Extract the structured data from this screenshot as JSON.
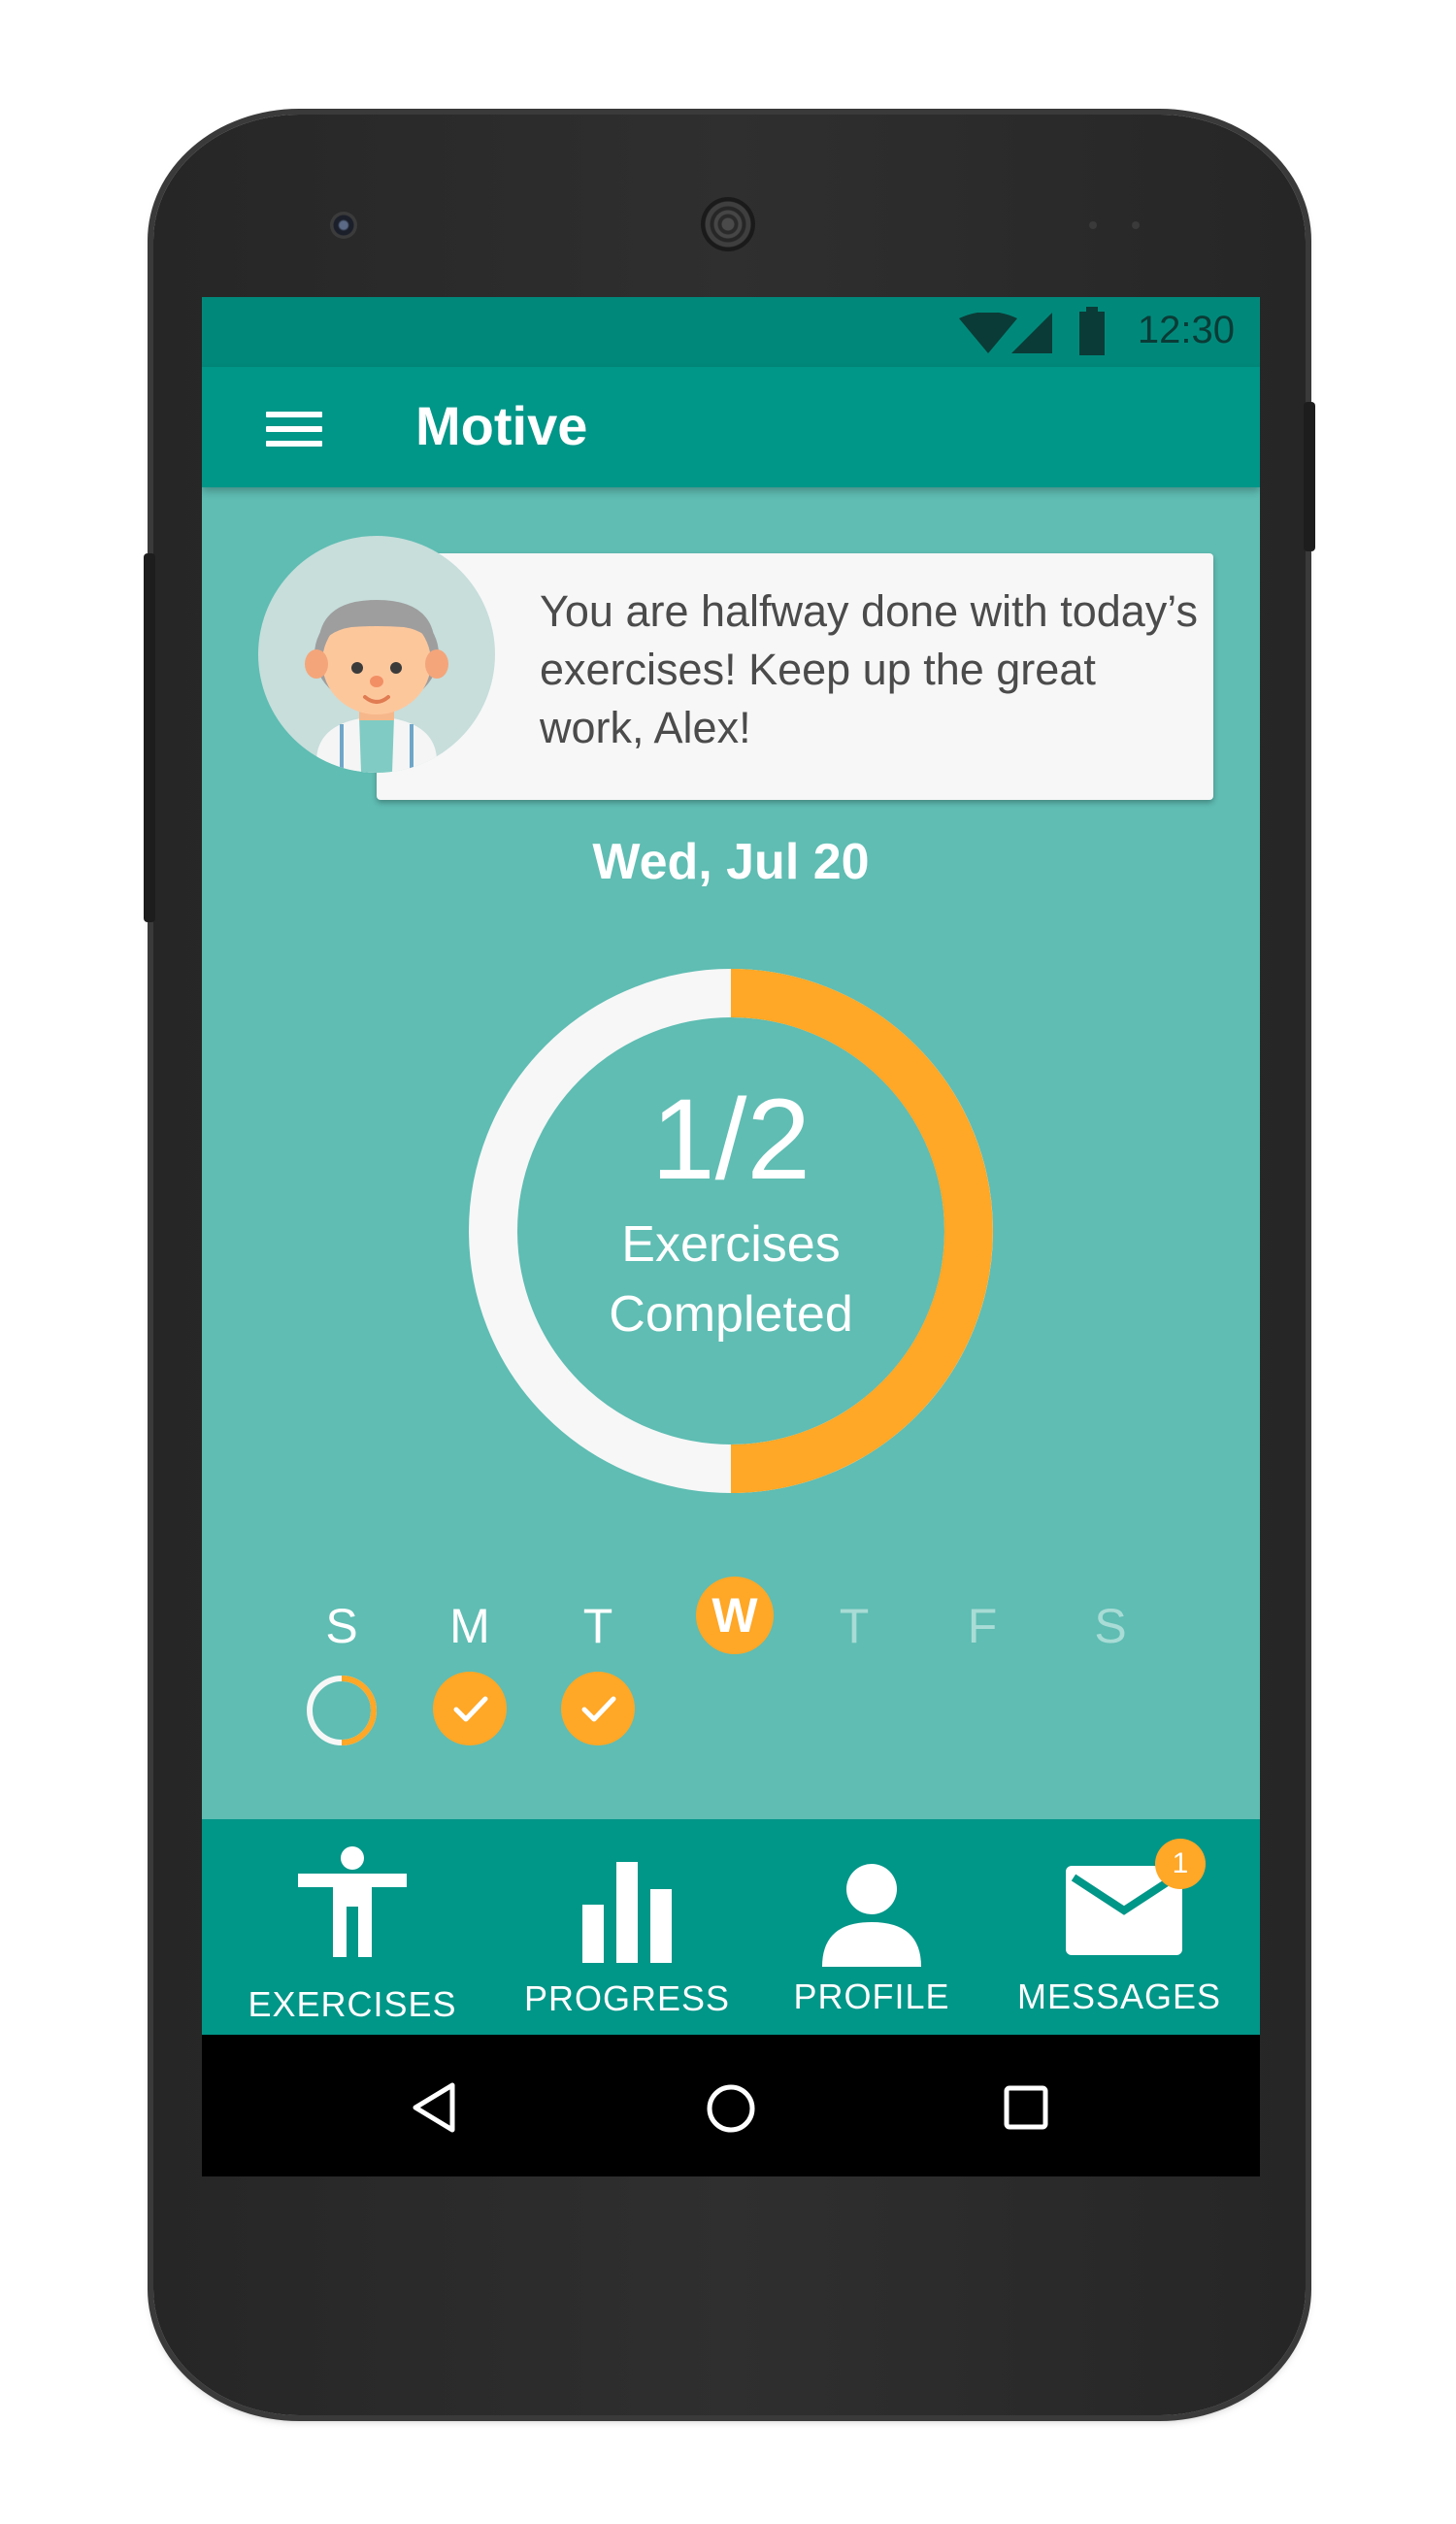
{
  "status_bar": {
    "time": "12:30"
  },
  "app_bar": {
    "title": "Motive"
  },
  "coach": {
    "message": "You are halfway done with today’s exercises! Keep up the great work, Alex!"
  },
  "date": "Wed, Jul 20",
  "progress": {
    "completed": 1,
    "total": 2,
    "count_text": "1/2",
    "label_line1": "Exercises",
    "label_line2": "Completed"
  },
  "week": {
    "days": [
      "S",
      "M",
      "T",
      "W",
      "T",
      "F",
      "S"
    ],
    "current_index": 3,
    "status": [
      "partial",
      "done",
      "done",
      "current",
      "future",
      "future",
      "future"
    ]
  },
  "bottom_nav": {
    "exercises": "EXERCISES",
    "progress": "PROGRESS",
    "profile": "PROFILE",
    "messages": "MESSAGES",
    "messages_badge": "1"
  },
  "colors": {
    "teal_dark": "#00897b",
    "teal": "#009688",
    "teal_light": "#5fbdb3",
    "accent": "#ffa726"
  }
}
